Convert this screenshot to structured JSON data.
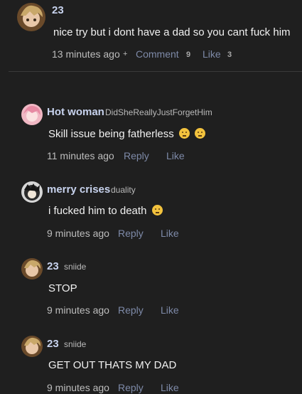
{
  "top_comment": {
    "author": "23",
    "text": "nice try but i dont have a dad so you cant fuck him",
    "time": "13 minutes ago",
    "plus": "+",
    "comment_label": "Comment",
    "comment_count": "9",
    "like_label": "Like",
    "like_count": "3"
  },
  "replies": [
    {
      "author": "Hot woman",
      "handle": "DidSheReallyJustForgetHim",
      "text": "Skill issue being fatherless",
      "emoji": [
        "raised-eyebrow-emoji",
        "raised-eyebrow-emoji"
      ],
      "time": "11 minutes ago",
      "reply_label": "Reply",
      "like_label": "Like"
    },
    {
      "author": "merry crises",
      "handle": "duality",
      "text": "i fucked him to death",
      "emoji": [
        "pensive-emoji"
      ],
      "time": "9 minutes ago",
      "reply_label": "Reply",
      "like_label": "Like"
    },
    {
      "author": "23",
      "handle": "sniide",
      "text": "STOP",
      "time": "9 minutes ago",
      "reply_label": "Reply",
      "like_label": "Like"
    },
    {
      "author": "23",
      "handle": "sniide",
      "text": "GET OUT THATS MY DAD",
      "time": "9 minutes ago",
      "reply_label": "Reply",
      "like_label": "Like"
    }
  ]
}
